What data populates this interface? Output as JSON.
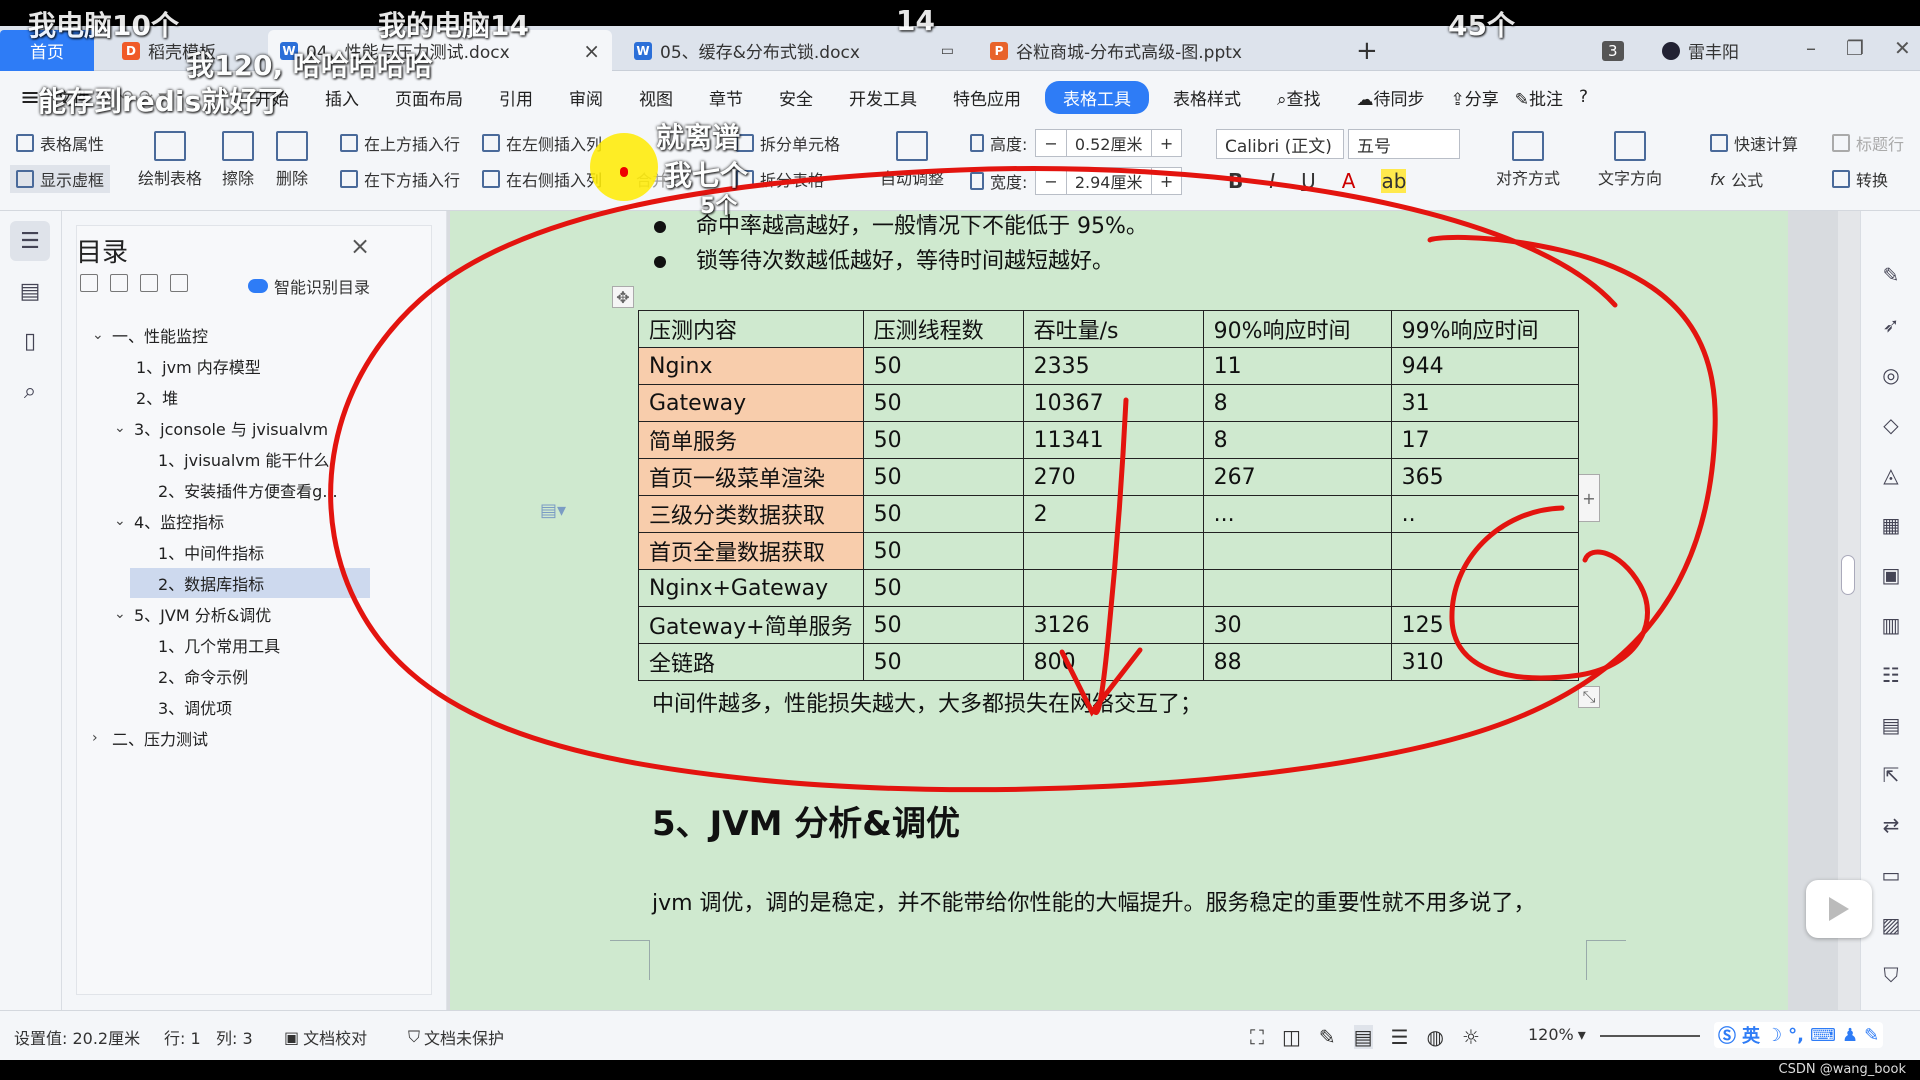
{
  "overlays": {
    "top_left": "我电脑10个",
    "top_mid": "我的电脑14",
    "top_num": "14",
    "top_right": "45个",
    "sub1": "我120, 哈哈哈哈哈",
    "sub2": "能存到redis就好了",
    "sub3": "就离谱",
    "sub4": "我七个",
    "sub5": "5个"
  },
  "tabs": {
    "home": "首页",
    "t1": "稻壳模板",
    "t2": "04、性能与压力测试.docx",
    "t3": "05、缓存&分布式锁.docx",
    "t4": "谷粒商城-分布式高级-图.pptx",
    "count_badge": "3",
    "user": "雷丰阳"
  },
  "menu": {
    "hamburger": "≡",
    "file": "文件",
    "start": "开始",
    "insert": "插入",
    "layout": "页面布局",
    "reference": "引用",
    "review": "审阅",
    "view": "视图",
    "chapter": "章节",
    "security": "安全",
    "devtools": "开发工具",
    "special": "特色应用",
    "table_tools": "表格工具",
    "table_style": "表格样式",
    "search": "查找",
    "sync": "待同步",
    "share": "分享",
    "annotate": "批注",
    "help": "?"
  },
  "ribbon": {
    "table_props": "表格属性",
    "show_border": "显示虚框",
    "draw_table": "绘制表格",
    "erase": "擦除",
    "delete": "删除",
    "insert_above": "在上方插入行",
    "insert_below": "在下方插入行",
    "insert_left": "在左侧插入列",
    "insert_right": "在右侧插入列",
    "merge": "合并",
    "split_cell": "拆分单元格",
    "split_table": "拆分表格",
    "autofit": "自动调整",
    "height_label": "高度:",
    "height_value": "0.52厘米",
    "width_label": "宽度:",
    "width_value": "2.94厘米",
    "font_name": "Calibri (正文)",
    "font_size": "五号",
    "align": "对齐方式",
    "text_dir": "文字方向",
    "quick_calc": "快速计算",
    "title_row": "标题行",
    "formula": "公式",
    "convert": "转换"
  },
  "toc": {
    "title": "目录",
    "smart": "智能识别目录",
    "items": [
      {
        "text": "一、性能监控"
      },
      {
        "text": "1、jvm 内存模型"
      },
      {
        "text": "2、堆"
      },
      {
        "text": "3、jconsole 与 jvisualvm"
      },
      {
        "text": "1、jvisualvm 能干什么"
      },
      {
        "text": "2、安装插件方便查看g..."
      },
      {
        "text": "4、监控指标"
      },
      {
        "text": "1、中间件指标"
      },
      {
        "text": "2、数据库指标"
      },
      {
        "text": "5、JVM 分析&调优"
      },
      {
        "text": "1、几个常用工具"
      },
      {
        "text": "2、命令示例"
      },
      {
        "text": "3、调优项"
      },
      {
        "text": "二、压力测试"
      }
    ]
  },
  "doc": {
    "bullet1": "命中率越高越好，一般情况下不能低于 95%。",
    "bullet2": "锁等待次数越低越好，等待时间越短越好。",
    "table": {
      "headers": [
        "压测内容",
        "压测线程数",
        "吞吐量/s",
        "90%响应时间",
        "99%响应时间"
      ],
      "rows": [
        [
          "Nginx",
          "50",
          "2335",
          "11",
          "944"
        ],
        [
          "Gateway",
          "50",
          "10367",
          "8",
          "31"
        ],
        [
          "简单服务",
          "50",
          "11341",
          "8",
          "17"
        ],
        [
          "首页一级菜单渲染",
          "50",
          "270",
          "267",
          "365"
        ],
        [
          "三级分类数据获取",
          "50",
          "2",
          "...",
          ".."
        ],
        [
          "首页全量数据获取",
          "50",
          "",
          "",
          ""
        ],
        [
          "Nginx+Gateway",
          "50",
          "",
          "",
          ""
        ],
        [
          "Gateway+简单服务",
          "50",
          "3126",
          "30",
          "125"
        ],
        [
          "全链路",
          "50",
          "800",
          "88",
          "310"
        ]
      ]
    },
    "caption": "中间件越多，性能损失越大，大多都损失在网络交互了；",
    "heading": "5、JVM 分析&调优",
    "paragraph": "jvm 调优，调的是稳定，并不能带给你性能的大幅提升。服务稳定的重要性就不用多说了，"
  },
  "status": {
    "position": "设置值: 20.2厘米",
    "row": "行: 1",
    "col": "列: 3",
    "proof": "文档校对",
    "protect": "文档未保护",
    "zoom": "120%",
    "ime": "英",
    "watermark": "CSDN @wang_book"
  },
  "colors": {
    "accent": "#2e7cf6",
    "page_bg": "#cfe9cf",
    "highlight_cell": "#f8cdac",
    "ink": "#e3140f"
  }
}
